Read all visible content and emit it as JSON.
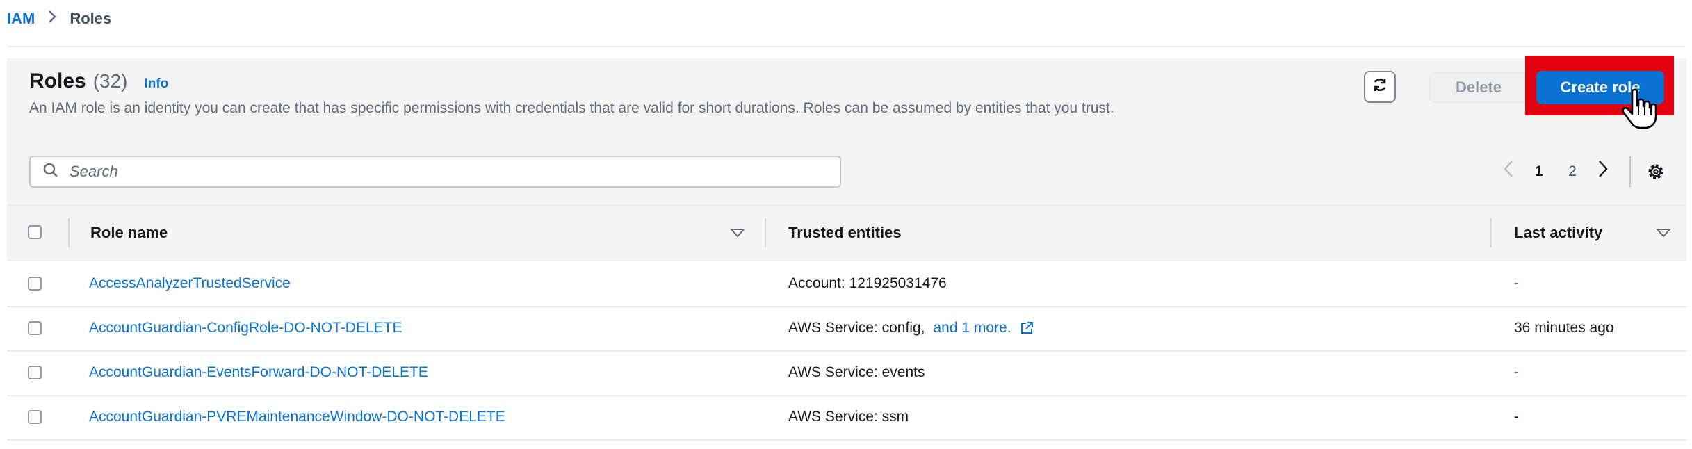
{
  "breadcrumb": {
    "root": "IAM",
    "separator": ">",
    "current": "Roles"
  },
  "header": {
    "title": "Roles",
    "count": "(32)",
    "info": "Info",
    "description": "An IAM role is an identity you can create that has specific permissions with credentials that are valid for short durations. Roles can be assumed by entities that you trust.",
    "delete_label": "Delete",
    "create_label": "Create role"
  },
  "search": {
    "placeholder": "Search",
    "value": ""
  },
  "pagination": {
    "pages": [
      "1",
      "2"
    ],
    "current": "1"
  },
  "table": {
    "columns": [
      "Role name",
      "Trusted entities",
      "Last activity"
    ],
    "rows": [
      {
        "name": "AccessAnalyzerTrustedService",
        "trusted": "Account: 121925031476",
        "more": "",
        "activity": "-"
      },
      {
        "name": "AccountGuardian-ConfigRole-DO-NOT-DELETE",
        "trusted": "AWS Service: config,",
        "more": "and 1 more.",
        "activity": "36 minutes ago"
      },
      {
        "name": "AccountGuardian-EventsForward-DO-NOT-DELETE",
        "trusted": "AWS Service: events",
        "more": "",
        "activity": "-"
      },
      {
        "name": "AccountGuardian-PVREMaintenanceWindow-DO-NOT-DELETE",
        "trusted": "AWS Service: ssm",
        "more": "",
        "activity": "-"
      }
    ]
  },
  "colors": {
    "accent": "#0972d3",
    "highlight": "#e3000f",
    "header_bg": "#f4f4f4"
  },
  "icons": [
    "chevron-right-icon",
    "refresh-icon",
    "pointer-hand-icon",
    "search-icon",
    "chevron-left-icon",
    "settings-gear-icon",
    "sort-down-icon",
    "external-link-icon"
  ]
}
